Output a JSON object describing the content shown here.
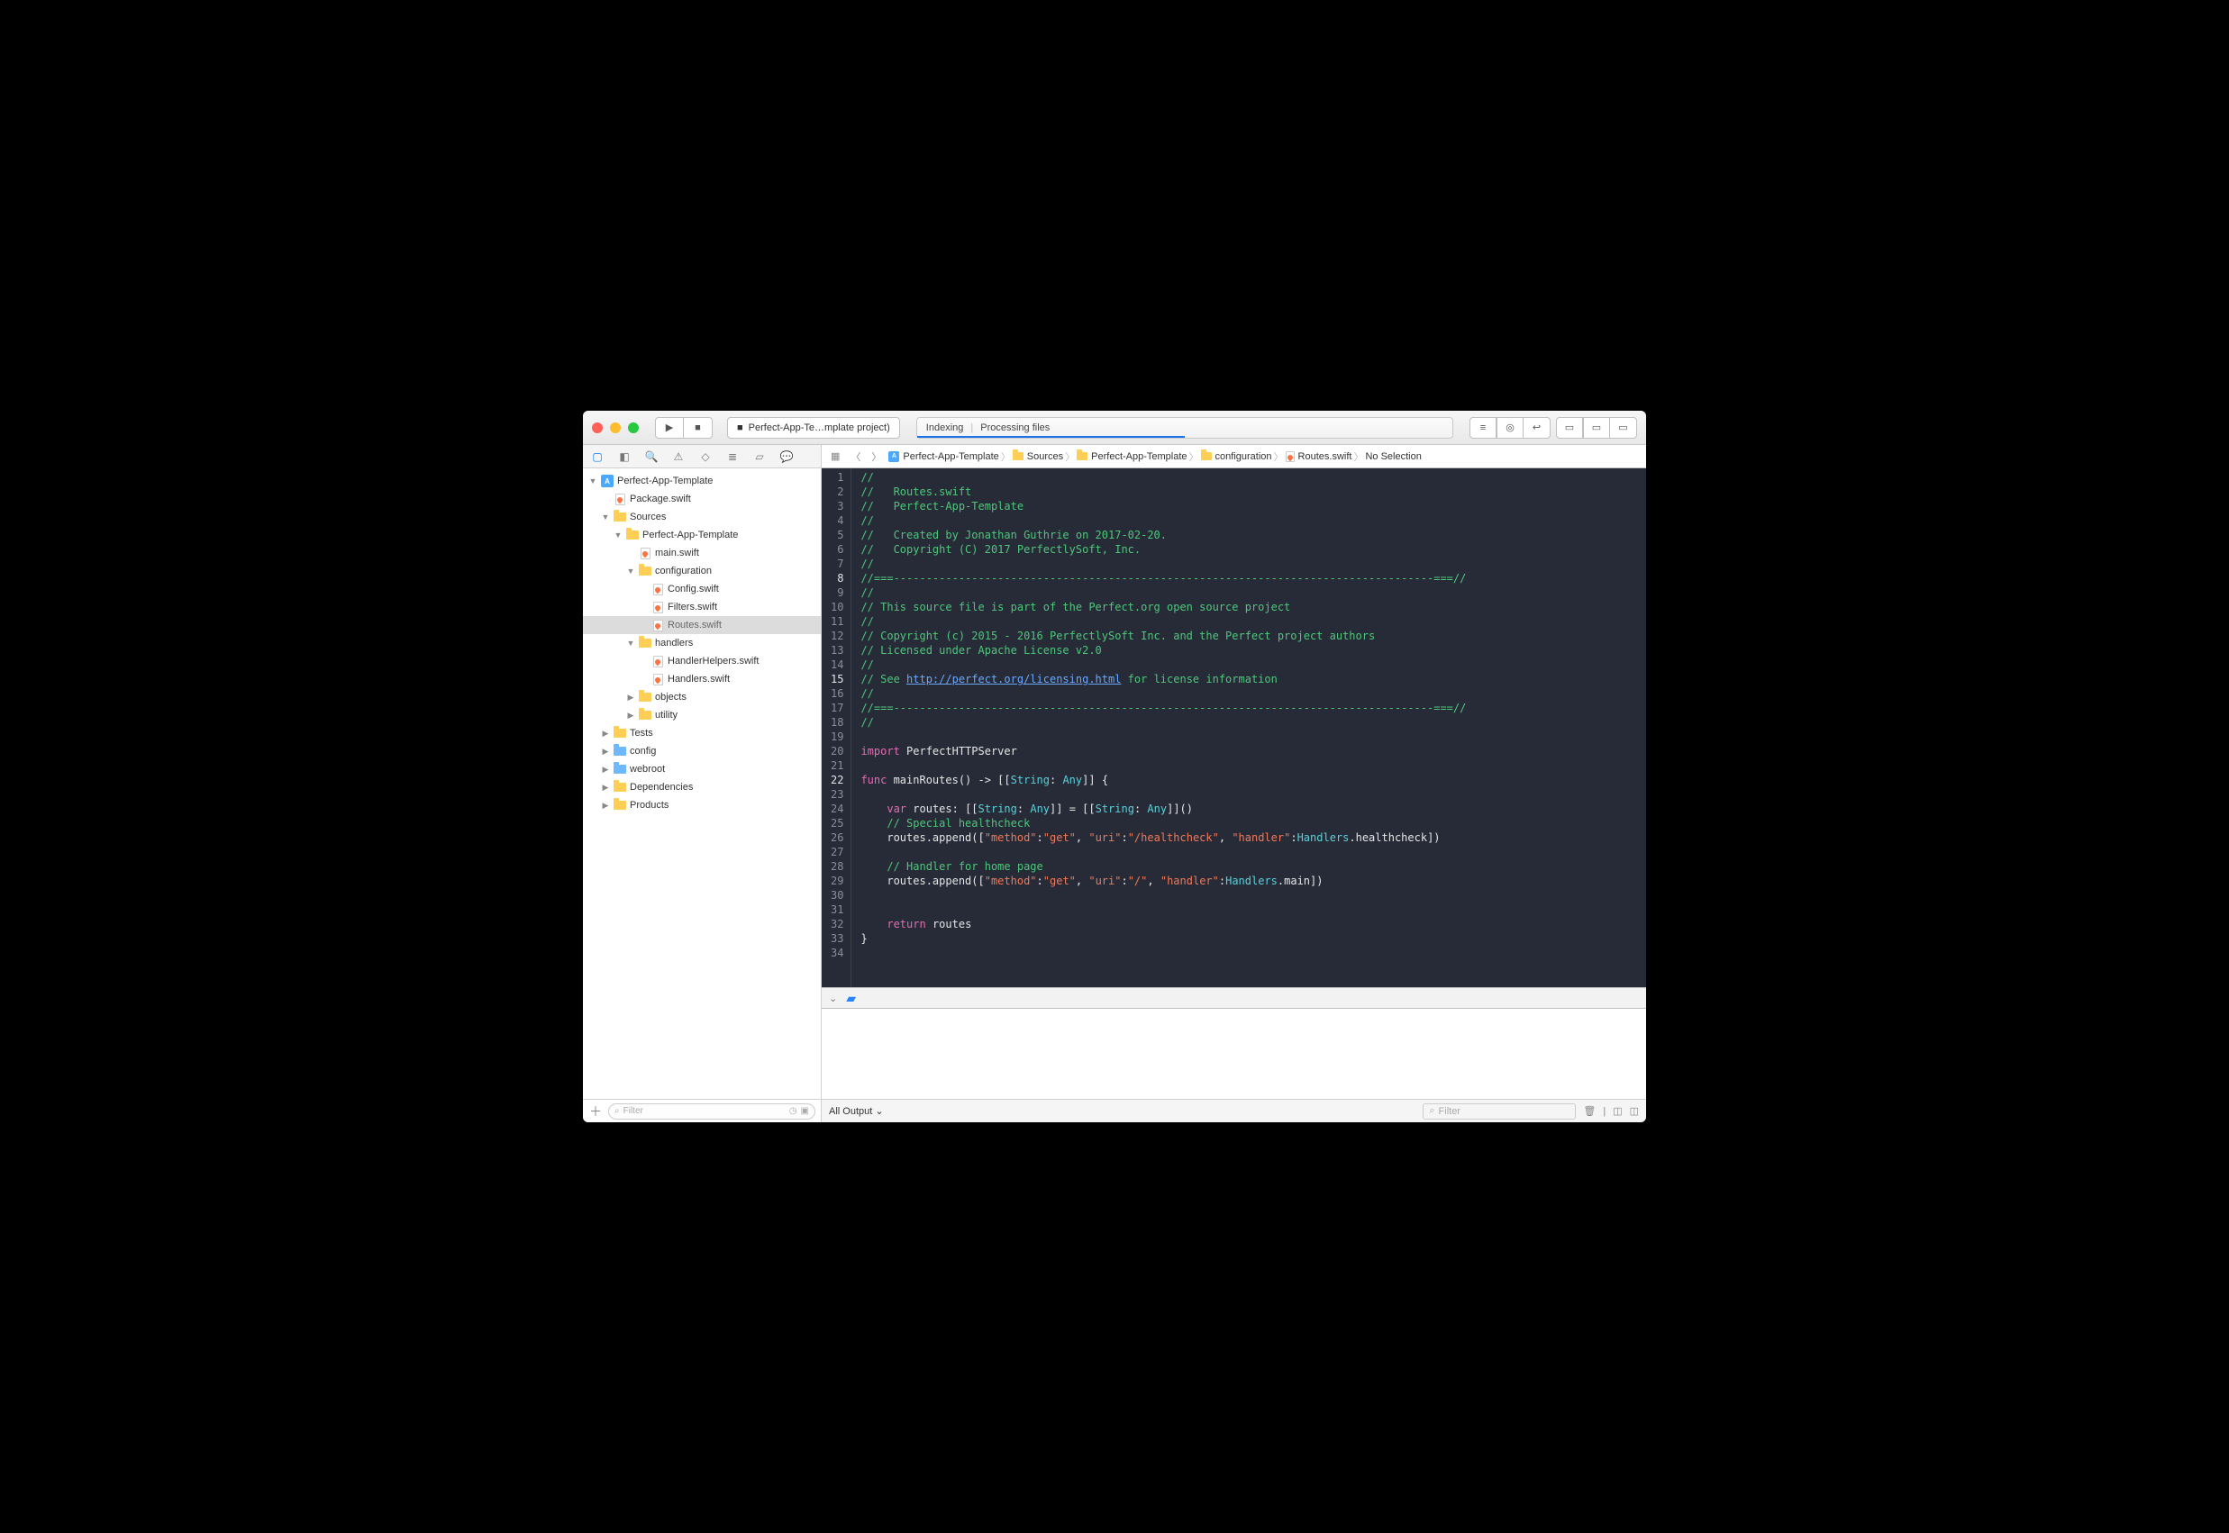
{
  "toolbar": {
    "scheme": "Perfect-App-Te…mplate project)",
    "activity": {
      "left": "Indexing",
      "right": "Processing files"
    }
  },
  "navigator_tabs": [
    "project",
    "source-control",
    "symbol",
    "search",
    "issue",
    "test",
    "debug",
    "breakpoint",
    "log"
  ],
  "project_tree": {
    "root": "Perfect-App-Template",
    "items": [
      {
        "depth": 0,
        "type": "project",
        "label": "Perfect-App-Template",
        "open": true
      },
      {
        "depth": 1,
        "type": "file-swift",
        "label": "Package.swift"
      },
      {
        "depth": 1,
        "type": "folder",
        "label": "Sources",
        "open": true
      },
      {
        "depth": 2,
        "type": "folder",
        "label": "Perfect-App-Template",
        "open": true
      },
      {
        "depth": 3,
        "type": "file-swift",
        "label": "main.swift"
      },
      {
        "depth": 3,
        "type": "folder",
        "label": "configuration",
        "open": true
      },
      {
        "depth": 4,
        "type": "file-swift",
        "label": "Config.swift"
      },
      {
        "depth": 4,
        "type": "file-swift",
        "label": "Filters.swift"
      },
      {
        "depth": 4,
        "type": "file-swift",
        "label": "Routes.swift",
        "selected": true
      },
      {
        "depth": 3,
        "type": "folder",
        "label": "handlers",
        "open": true
      },
      {
        "depth": 4,
        "type": "file-swift",
        "label": "HandlerHelpers.swift"
      },
      {
        "depth": 4,
        "type": "file-swift",
        "label": "Handlers.swift"
      },
      {
        "depth": 3,
        "type": "folder",
        "label": "objects",
        "open": false
      },
      {
        "depth": 3,
        "type": "folder",
        "label": "utility",
        "open": false
      },
      {
        "depth": 1,
        "type": "folder",
        "label": "Tests",
        "open": false
      },
      {
        "depth": 1,
        "type": "folder-blue",
        "label": "config",
        "open": false
      },
      {
        "depth": 1,
        "type": "folder-blue",
        "label": "webroot",
        "open": false
      },
      {
        "depth": 1,
        "type": "folder",
        "label": "Dependencies",
        "open": false
      },
      {
        "depth": 1,
        "type": "folder",
        "label": "Products",
        "open": false
      }
    ]
  },
  "sidebar_filter": {
    "placeholder": "Filter"
  },
  "jumpbar": [
    {
      "icon": "project",
      "label": "Perfect-App-Template"
    },
    {
      "icon": "folder",
      "label": "Sources"
    },
    {
      "icon": "folder",
      "label": "Perfect-App-Template"
    },
    {
      "icon": "folder",
      "label": "configuration"
    },
    {
      "icon": "file",
      "label": "Routes.swift"
    },
    {
      "icon": "none",
      "label": "No Selection"
    }
  ],
  "code": {
    "lines": [
      {
        "n": 1,
        "segs": [
          [
            "//",
            "comment"
          ]
        ]
      },
      {
        "n": 2,
        "segs": [
          [
            "//   Routes.swift",
            "comment"
          ]
        ]
      },
      {
        "n": 3,
        "segs": [
          [
            "//   Perfect-App-Template",
            "comment"
          ]
        ]
      },
      {
        "n": 4,
        "segs": [
          [
            "//",
            "comment"
          ]
        ]
      },
      {
        "n": 5,
        "segs": [
          [
            "//   Created by Jonathan Guthrie on 2017-02-20.",
            "comment"
          ]
        ]
      },
      {
        "n": 6,
        "segs": [
          [
            "//   Copyright (C) 2017 PerfectlySoft, Inc.",
            "comment"
          ]
        ]
      },
      {
        "n": 7,
        "segs": [
          [
            "//",
            "comment"
          ]
        ]
      },
      {
        "n": 8,
        "hl": true,
        "segs": [
          [
            "//===-----------------------------------------------------------------------------------===//",
            "comment"
          ]
        ]
      },
      {
        "n": 9,
        "segs": [
          [
            "//",
            "comment"
          ]
        ]
      },
      {
        "n": 10,
        "segs": [
          [
            "// This source file is part of the Perfect.org open source project",
            "comment"
          ]
        ]
      },
      {
        "n": 11,
        "segs": [
          [
            "//",
            "comment"
          ]
        ]
      },
      {
        "n": 12,
        "segs": [
          [
            "// Copyright (c) 2015 - 2016 PerfectlySoft Inc. and the Perfect project authors",
            "comment"
          ]
        ]
      },
      {
        "n": 13,
        "segs": [
          [
            "// Licensed under Apache License v2.0",
            "comment"
          ]
        ]
      },
      {
        "n": 14,
        "segs": [
          [
            "//",
            "comment"
          ]
        ]
      },
      {
        "n": 15,
        "hl": true,
        "segs": [
          [
            "// See ",
            "comment"
          ],
          [
            "http://perfect.org/licensing.html",
            "link"
          ],
          [
            " for license information",
            "comment"
          ]
        ]
      },
      {
        "n": 16,
        "segs": [
          [
            "//",
            "comment"
          ]
        ]
      },
      {
        "n": 17,
        "segs": [
          [
            "//===-----------------------------------------------------------------------------------===//",
            "comment"
          ]
        ]
      },
      {
        "n": 18,
        "segs": [
          [
            "//",
            "comment"
          ]
        ]
      },
      {
        "n": 19,
        "segs": [
          [
            "",
            ""
          ]
        ]
      },
      {
        "n": 20,
        "segs": [
          [
            "import",
            "key"
          ],
          [
            " PerfectHTTPServer",
            ""
          ]
        ]
      },
      {
        "n": 21,
        "segs": [
          [
            "",
            ""
          ]
        ]
      },
      {
        "n": 22,
        "hl": true,
        "segs": [
          [
            "func",
            "key"
          ],
          [
            " mainRoutes() -> [[",
            ""
          ],
          [
            "String",
            "type"
          ],
          [
            ": ",
            ""
          ],
          [
            "Any",
            "type"
          ],
          [
            "]] {",
            ""
          ]
        ]
      },
      {
        "n": 23,
        "segs": [
          [
            "",
            ""
          ]
        ]
      },
      {
        "n": 24,
        "segs": [
          [
            "    ",
            ""
          ],
          [
            "var",
            "key"
          ],
          [
            " routes: [[",
            ""
          ],
          [
            "String",
            "type"
          ],
          [
            ": ",
            ""
          ],
          [
            "Any",
            "type"
          ],
          [
            "]] = [[",
            ""
          ],
          [
            "String",
            "type"
          ],
          [
            ": ",
            ""
          ],
          [
            "Any",
            "type"
          ],
          [
            "]]()",
            ""
          ]
        ]
      },
      {
        "n": 25,
        "segs": [
          [
            "    ",
            ""
          ],
          [
            "// Special healthcheck",
            "comment"
          ]
        ]
      },
      {
        "n": 26,
        "segs": [
          [
            "    routes.append([",
            ""
          ],
          [
            "\"method\"",
            "str"
          ],
          [
            ":",
            ""
          ],
          [
            "\"get\"",
            "str"
          ],
          [
            ", ",
            ""
          ],
          [
            "\"uri\"",
            "str"
          ],
          [
            ":",
            ""
          ],
          [
            "\"/healthcheck\"",
            "str"
          ],
          [
            ", ",
            ""
          ],
          [
            "\"handler\"",
            "str"
          ],
          [
            ":",
            ""
          ],
          [
            "Handlers",
            "type"
          ],
          [
            ".healthcheck])",
            ""
          ]
        ]
      },
      {
        "n": 27,
        "segs": [
          [
            "",
            ""
          ]
        ]
      },
      {
        "n": 28,
        "segs": [
          [
            "    ",
            ""
          ],
          [
            "// Handler for home page",
            "comment"
          ]
        ]
      },
      {
        "n": 29,
        "segs": [
          [
            "    routes.append([",
            ""
          ],
          [
            "\"method\"",
            "str"
          ],
          [
            ":",
            ""
          ],
          [
            "\"get\"",
            "str"
          ],
          [
            ", ",
            ""
          ],
          [
            "\"uri\"",
            "str"
          ],
          [
            ":",
            ""
          ],
          [
            "\"/\"",
            "str"
          ],
          [
            ", ",
            ""
          ],
          [
            "\"handler\"",
            "str"
          ],
          [
            ":",
            ""
          ],
          [
            "Handlers",
            "type"
          ],
          [
            ".main])",
            ""
          ]
        ]
      },
      {
        "n": 30,
        "segs": [
          [
            "",
            ""
          ]
        ]
      },
      {
        "n": 31,
        "segs": [
          [
            "",
            ""
          ]
        ]
      },
      {
        "n": 32,
        "segs": [
          [
            "    ",
            ""
          ],
          [
            "return",
            "key"
          ],
          [
            " routes",
            ""
          ]
        ]
      },
      {
        "n": 33,
        "segs": [
          [
            "}",
            ""
          ]
        ]
      },
      {
        "n": 34,
        "segs": [
          [
            "",
            ""
          ]
        ]
      }
    ]
  },
  "console": {
    "output_label": "All Output",
    "filter_placeholder": "Filter"
  }
}
